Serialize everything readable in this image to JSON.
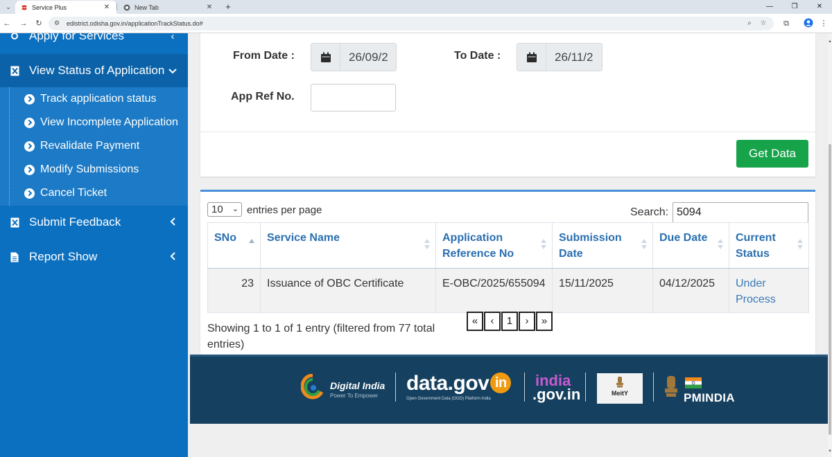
{
  "browser": {
    "tabs": [
      {
        "title": "Service Plus",
        "active": true
      },
      {
        "title": "New Tab",
        "active": false
      }
    ],
    "url": "edistrict.odisha.gov.in/applicationTrackStatus.do#"
  },
  "sidebar": {
    "top_item": "Apply for Services",
    "active_item": "View Status of Application",
    "sub_items": [
      "Track application status",
      "View Incomplete Application",
      "Revalidate Payment",
      "Modify Submissions",
      "Cancel Ticket"
    ],
    "items": [
      "Submit Feedback",
      "Report Show"
    ]
  },
  "form": {
    "from_label": "From Date :",
    "from_value": "26/09/2",
    "to_label": "To Date :",
    "to_value": "26/11/2",
    "ref_label": "App Ref No.",
    "ref_value": "",
    "submit_label": "Get Data"
  },
  "table_controls": {
    "page_size": "10",
    "per_page_text": "entries per page",
    "search_label": "Search:",
    "search_value": "5094"
  },
  "table": {
    "columns": [
      "SNo",
      "Service Name",
      "Application Reference No",
      "Submission Date",
      "Due Date",
      "Current Status"
    ],
    "rows": [
      {
        "sno": "23",
        "service": "Issuance of OBC Certificate",
        "ref": "E-OBC/2025/655094",
        "submitted": "15/11/2025",
        "due": "04/12/2025",
        "status": "Under Process"
      }
    ],
    "info": "Showing 1 to 1 of 1 entry (filtered from 77 total entries)",
    "pagination": [
      "«",
      "‹",
      "1",
      "›",
      "»"
    ]
  },
  "footer": {
    "digital_india": "Digital India",
    "digital_india_tagline": "Power To Empower",
    "datagov": "data.gov",
    "datagov_in": "in",
    "datagov_tagline": "Open Government Data (OGD) Platform India",
    "indiagov_top": "india",
    "indiagov_bottom": ".gov.in",
    "meity": "MeitY",
    "pmindia": "PMINDIA"
  },
  "colors": {
    "sidebar": "#0c70c0",
    "accent_green": "#16a34a",
    "table_header_text": "#2a6fb0",
    "footer": "#15405f"
  }
}
